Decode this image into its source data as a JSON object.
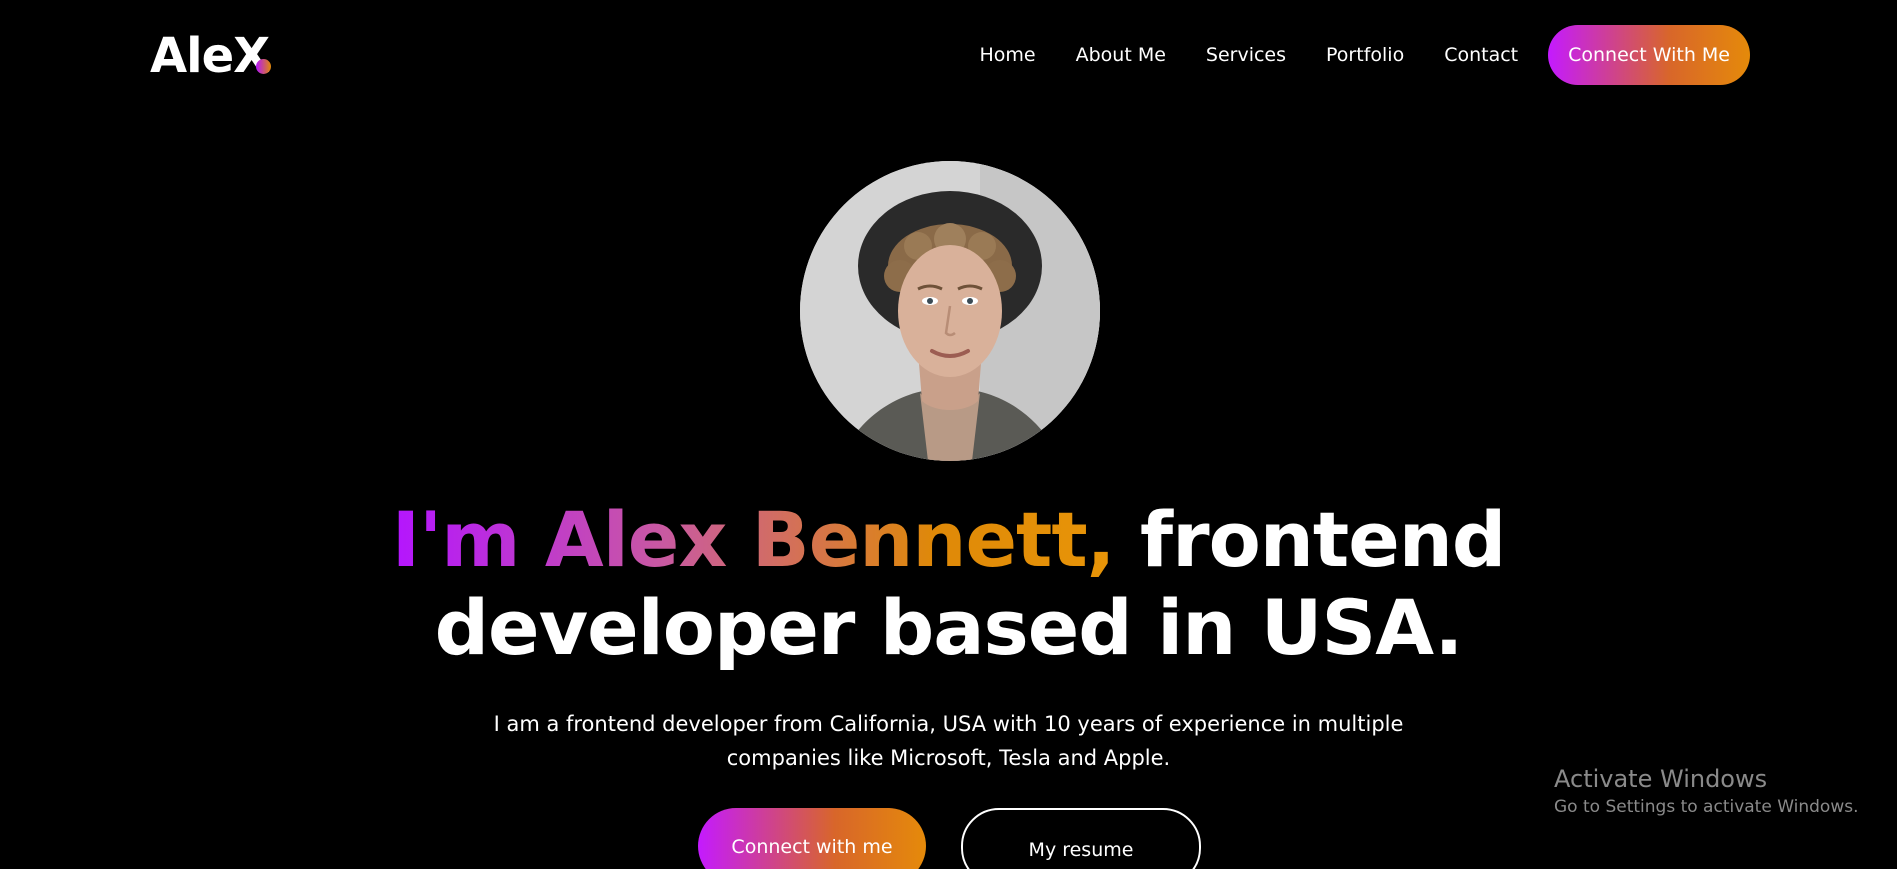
{
  "header": {
    "logo": "AleX",
    "nav": [
      "Home",
      "About Me",
      "Services",
      "Portfolio",
      "Contact"
    ],
    "cta_label": "Connect With Me"
  },
  "hero": {
    "headline_gradient": "I'm Alex Bennett,",
    "headline_rest_line1": " frontend",
    "headline_line2": "developer based in USA.",
    "intro_line1": "I am a frontend developer from California, USA with 10 years of experience in multiple",
    "intro_line2": "companies like Microsoft, Tesla and Apple.",
    "primary_button": "Connect with me",
    "secondary_button": "My resume"
  },
  "watermark": {
    "title": "Activate Windows",
    "subtitle": "Go to Settings to activate Windows."
  },
  "colors": {
    "background": "#000000",
    "gradient_start": "#b415ff",
    "gradient_end": "#df8908",
    "text": "#ffffff"
  }
}
